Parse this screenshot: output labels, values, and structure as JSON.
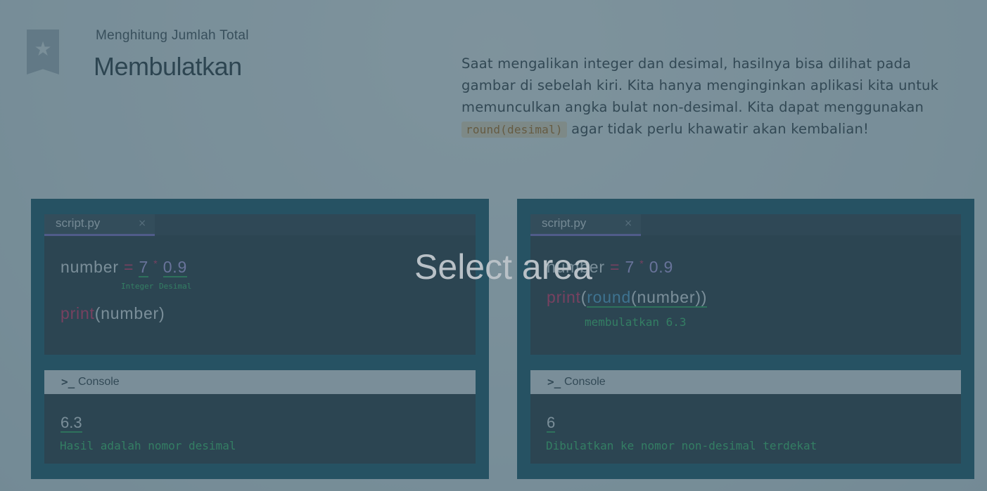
{
  "header": {
    "subtitle": "Menghitung Jumlah Total",
    "title": "Membulatkan",
    "bookmark_icon": "star-icon"
  },
  "description": {
    "text_before": "Saat mengalikan integer dan desimal, hasilnya bisa dilihat pada gambar di sebelah kiri. Kita hanya menginginkan aplikasi kita untuk memunculkan angka bulat non-desimal. Kita dapat menggunakan ",
    "code": "round(desimal)",
    "text_after": " agar tidak perlu khawatir akan kembalian!"
  },
  "left_panel": {
    "tab_name": "script.py",
    "tab_close": "×",
    "line1": {
      "var": "number",
      "eq": "=",
      "int": "7",
      "mul": "*",
      "dec": "0.9"
    },
    "note_integer": "Integer",
    "note_desimal": "Desimal",
    "line2": {
      "fn": "print",
      "open": "(",
      "arg": "number",
      "close": ")"
    },
    "console_label": "Console",
    "console_icon": ">_",
    "output": "6.3",
    "output_note": "Hasil adalah nomor desimal"
  },
  "right_panel": {
    "tab_name": "script.py",
    "tab_close": "×",
    "line1": {
      "var": "number",
      "eq": "=",
      "int": "7",
      "mul": "*",
      "dec": "0.9"
    },
    "line2": {
      "fn": "print",
      "open": "(",
      "fn2": "round",
      "open2": "(",
      "arg": "number",
      "close": "))"
    },
    "note_round": "membulatkan 6.3",
    "console_label": "Console",
    "console_icon": ">_",
    "output": "6",
    "output_note": "Dibulatkan ke nomor non-desimal terdekat"
  },
  "overlay": {
    "label": "Select area"
  },
  "colors": {
    "panel_bg": "#0b4c62",
    "editor_bg": "#1c2a36",
    "keyword": "#e0205a",
    "note_green": "#2fbf63",
    "code_chip_text": "#b0640b"
  }
}
